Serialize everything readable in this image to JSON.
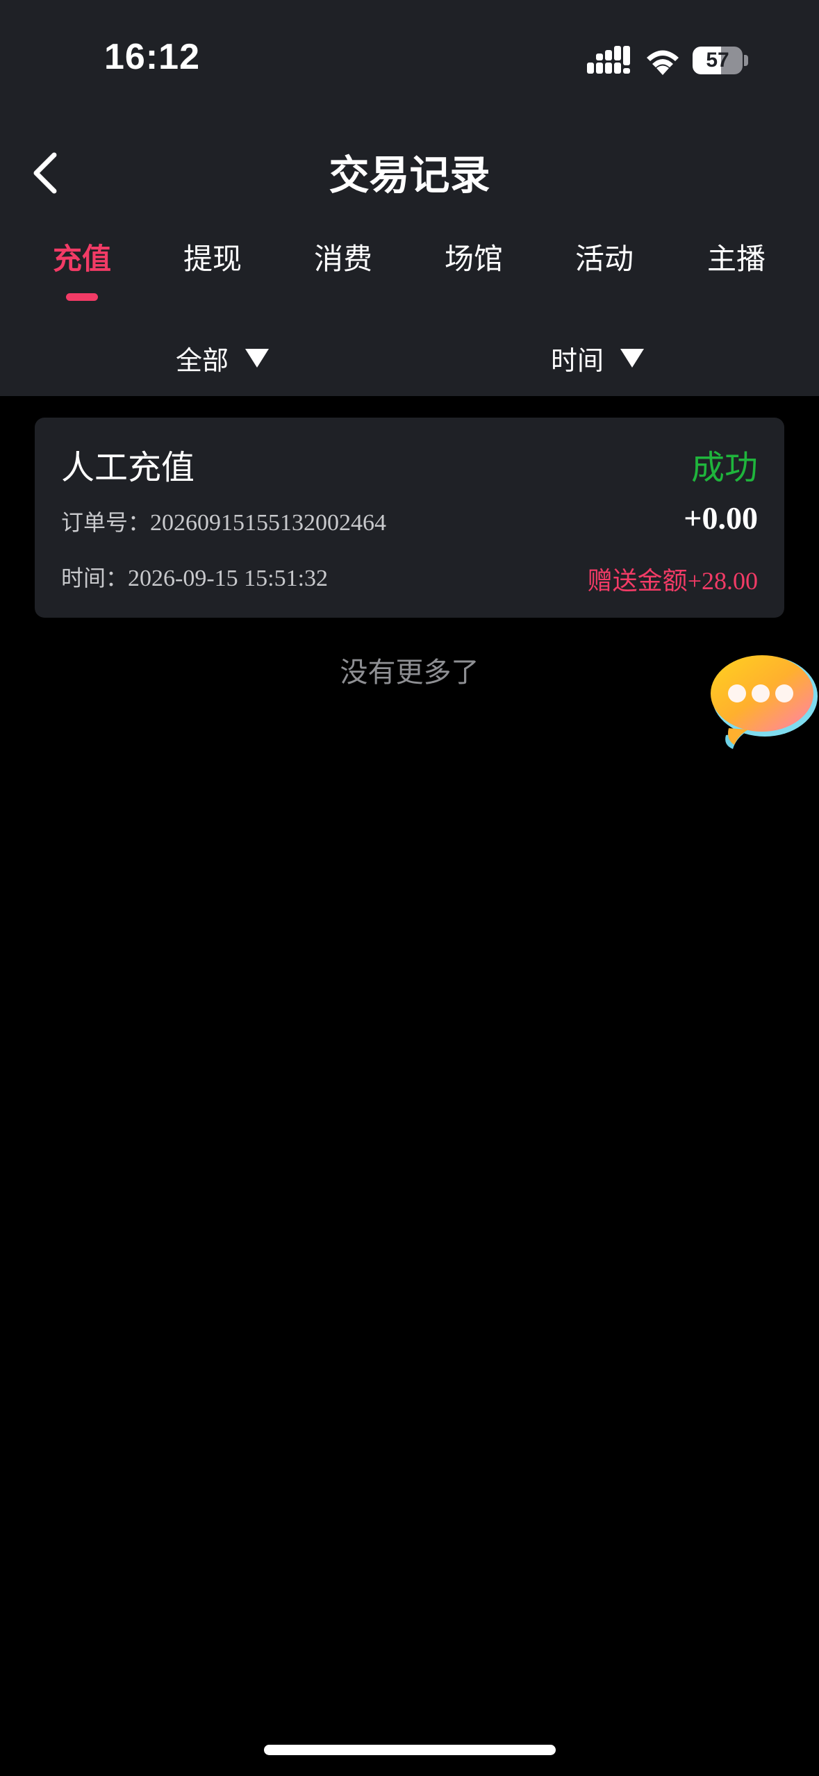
{
  "status_bar": {
    "time": "16:12",
    "battery_level": "57",
    "battery_fraction": 0.57,
    "icons": [
      "signal-icon",
      "wifi-icon",
      "battery-icon"
    ]
  },
  "nav": {
    "title": "交易记录",
    "back_icon": "chevron-left-icon"
  },
  "tabs": [
    {
      "label": "充值",
      "active": true
    },
    {
      "label": "提现",
      "active": false
    },
    {
      "label": "消费",
      "active": false
    },
    {
      "label": "场馆",
      "active": false
    },
    {
      "label": "活动",
      "active": false
    },
    {
      "label": "主播",
      "active": false
    }
  ],
  "filters": {
    "category": "全部",
    "time": "时间",
    "icon": "triangle-down-icon"
  },
  "records": [
    {
      "type": "人工充值",
      "status": "成功",
      "order_label": "订单号：",
      "order_no": "20260915155132002464",
      "amount": "+0.00",
      "time_label": "时间：",
      "time": "2026-09-15 15:51:32",
      "bonus_label": "赠送金额",
      "bonus_value": "+28.00"
    }
  ],
  "list_end_text": "没有更多了",
  "floating_icon": "chat-bubble-icon",
  "colors": {
    "accent": "#f23b66",
    "success": "#1fb53c",
    "panel": "#1f2126",
    "background": "#000000"
  }
}
